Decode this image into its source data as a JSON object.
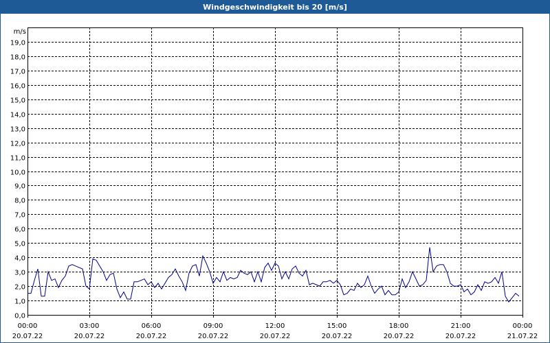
{
  "window": {
    "title": "Windgeschwindigkeit bis 20 [m/s]"
  },
  "colors": {
    "title_bar": "#1e5a96",
    "line": "#00008b",
    "grid": "#000000"
  },
  "chart_data": {
    "type": "line",
    "title": "Windgeschwindigkeit bis 20 [m/s]",
    "ylabel": "m/s",
    "xlabel": "",
    "ylim": [
      0,
      20
    ],
    "xlim": [
      "2022-07-20 00:00",
      "2022-07-21 00:00"
    ],
    "grid": true,
    "yticks": [
      "0,0",
      "1,0",
      "2,0",
      "3,0",
      "4,0",
      "5,0",
      "6,0",
      "7,0",
      "8,0",
      "9,0",
      "10,0",
      "11,0",
      "12,0",
      "13,0",
      "14,0",
      "15,0",
      "16,0",
      "17,0",
      "18,0",
      "19,0"
    ],
    "xticks": [
      {
        "time": "00:00",
        "date": "20.07.22"
      },
      {
        "time": "03:00",
        "date": "20.07.22"
      },
      {
        "time": "06:00",
        "date": "20.07.22"
      },
      {
        "time": "09:00",
        "date": "20.07.22"
      },
      {
        "time": "12:00",
        "date": "20.07.22"
      },
      {
        "time": "15:00",
        "date": "20.07.22"
      },
      {
        "time": "18:00",
        "date": "20.07.22"
      },
      {
        "time": "21:00",
        "date": "20.07.22"
      },
      {
        "time": "00:00",
        "date": "21.07.22"
      }
    ],
    "series": [
      {
        "x": [
          "2022-07-20 00:00",
          "2022-07-20 00:10",
          "2022-07-20 00:20",
          "2022-07-20 00:30",
          "2022-07-20 00:40",
          "2022-07-20 00:50",
          "2022-07-20 01:00",
          "2022-07-20 01:10",
          "2022-07-20 01:20",
          "2022-07-20 01:30",
          "2022-07-20 01:40",
          "2022-07-20 01:50",
          "2022-07-20 02:00",
          "2022-07-20 02:10",
          "2022-07-20 02:20",
          "2022-07-20 02:30",
          "2022-07-20 02:40",
          "2022-07-20 02:50",
          "2022-07-20 03:00",
          "2022-07-20 03:10",
          "2022-07-20 03:20",
          "2022-07-20 03:30",
          "2022-07-20 03:40",
          "2022-07-20 03:50",
          "2022-07-20 04:00",
          "2022-07-20 04:10",
          "2022-07-20 04:20",
          "2022-07-20 04:30",
          "2022-07-20 04:40",
          "2022-07-20 04:50",
          "2022-07-20 05:00",
          "2022-07-20 05:10",
          "2022-07-20 05:20",
          "2022-07-20 05:30",
          "2022-07-20 05:40",
          "2022-07-20 05:50",
          "2022-07-20 06:00",
          "2022-07-20 06:10",
          "2022-07-20 06:20",
          "2022-07-20 06:30",
          "2022-07-20 06:40",
          "2022-07-20 06:50",
          "2022-07-20 07:00",
          "2022-07-20 07:10",
          "2022-07-20 07:20",
          "2022-07-20 07:30",
          "2022-07-20 07:40",
          "2022-07-20 07:50",
          "2022-07-20 08:00",
          "2022-07-20 08:10",
          "2022-07-20 08:20",
          "2022-07-20 08:30",
          "2022-07-20 08:40",
          "2022-07-20 08:50",
          "2022-07-20 09:00",
          "2022-07-20 09:10",
          "2022-07-20 09:20",
          "2022-07-20 09:30",
          "2022-07-20 09:40",
          "2022-07-20 09:50",
          "2022-07-20 10:00",
          "2022-07-20 10:10",
          "2022-07-20 10:20",
          "2022-07-20 10:30",
          "2022-07-20 10:40",
          "2022-07-20 10:50",
          "2022-07-20 11:00",
          "2022-07-20 11:10",
          "2022-07-20 11:20",
          "2022-07-20 11:30",
          "2022-07-20 11:40",
          "2022-07-20 11:50",
          "2022-07-20 12:00",
          "2022-07-20 12:10",
          "2022-07-20 12:20",
          "2022-07-20 12:30",
          "2022-07-20 12:40",
          "2022-07-20 12:50",
          "2022-07-20 13:00",
          "2022-07-20 13:10",
          "2022-07-20 13:20",
          "2022-07-20 13:30",
          "2022-07-20 13:40",
          "2022-07-20 13:50",
          "2022-07-20 14:00",
          "2022-07-20 14:10",
          "2022-07-20 14:20",
          "2022-07-20 14:30",
          "2022-07-20 14:40",
          "2022-07-20 14:50",
          "2022-07-20 15:00",
          "2022-07-20 15:10",
          "2022-07-20 15:20",
          "2022-07-20 15:30",
          "2022-07-20 15:40",
          "2022-07-20 15:50",
          "2022-07-20 16:00",
          "2022-07-20 16:10",
          "2022-07-20 16:20",
          "2022-07-20 16:30",
          "2022-07-20 16:40",
          "2022-07-20 16:50",
          "2022-07-20 17:00",
          "2022-07-20 17:10",
          "2022-07-20 17:20",
          "2022-07-20 17:30",
          "2022-07-20 17:40",
          "2022-07-20 17:50",
          "2022-07-20 18:00",
          "2022-07-20 18:10",
          "2022-07-20 18:20",
          "2022-07-20 18:30",
          "2022-07-20 18:40",
          "2022-07-20 18:50",
          "2022-07-20 19:00",
          "2022-07-20 19:10",
          "2022-07-20 19:20",
          "2022-07-20 19:30",
          "2022-07-20 19:40",
          "2022-07-20 19:50",
          "2022-07-20 20:00",
          "2022-07-20 20:10",
          "2022-07-20 20:20",
          "2022-07-20 20:30",
          "2022-07-20 20:40",
          "2022-07-20 20:50",
          "2022-07-20 21:00",
          "2022-07-20 21:10",
          "2022-07-20 21:20",
          "2022-07-20 21:30",
          "2022-07-20 21:40",
          "2022-07-20 21:50",
          "2022-07-20 22:00",
          "2022-07-20 22:10",
          "2022-07-20 22:20",
          "2022-07-20 22:30",
          "2022-07-20 22:40",
          "2022-07-20 22:50",
          "2022-07-20 23:00",
          "2022-07-20 23:10",
          "2022-07-20 23:20",
          "2022-07-20 23:30",
          "2022-07-20 23:40",
          "2022-07-20 23:50"
        ],
        "values": [
          1.5,
          1.5,
          2.4,
          3.2,
          1.3,
          1.3,
          3.0,
          2.4,
          2.5,
          1.9,
          2.4,
          2.7,
          3.4,
          3.5,
          3.4,
          3.3,
          3.2,
          2.0,
          1.8,
          3.9,
          3.8,
          3.4,
          3.0,
          2.4,
          2.8,
          2.9,
          1.8,
          1.2,
          1.6,
          1.1,
          1.1,
          2.3,
          2.3,
          2.4,
          2.5,
          2.1,
          2.3,
          1.9,
          2.2,
          1.8,
          2.2,
          2.6,
          2.8,
          3.2,
          2.7,
          2.3,
          1.7,
          2.9,
          3.4,
          3.5,
          2.7,
          4.1,
          3.6,
          3.0,
          2.2,
          2.6,
          2.3,
          3.0,
          2.4,
          2.6,
          2.5,
          2.6,
          3.1,
          2.9,
          2.8,
          3.0,
          2.3,
          3.0,
          2.3,
          3.3,
          3.6,
          3.1,
          3.6,
          3.4,
          2.5,
          3.0,
          2.5,
          3.2,
          3.4,
          2.9,
          2.7,
          3.1,
          2.1,
          2.2,
          2.1,
          2.0,
          2.3,
          2.3,
          2.4,
          2.2,
          2.4,
          2.1,
          1.4,
          1.5,
          1.8,
          1.7,
          2.2,
          1.9,
          2.1,
          2.7,
          2.0,
          1.5,
          1.8,
          2.0,
          1.4,
          1.7,
          1.4,
          1.4,
          1.6,
          2.5,
          1.9,
          2.3,
          3.0,
          2.5,
          2.0,
          2.1,
          2.4,
          4.7,
          3.0,
          3.4,
          3.5,
          3.5,
          3.0,
          2.2,
          2.0,
          2.0,
          2.1,
          1.6,
          1.8,
          1.4,
          1.6,
          2.1,
          1.7,
          2.3,
          2.2,
          2.3,
          2.6,
          2.2,
          3.0,
          1.3,
          0.9,
          1.2,
          1.5,
          1.3
        ]
      }
    ]
  }
}
